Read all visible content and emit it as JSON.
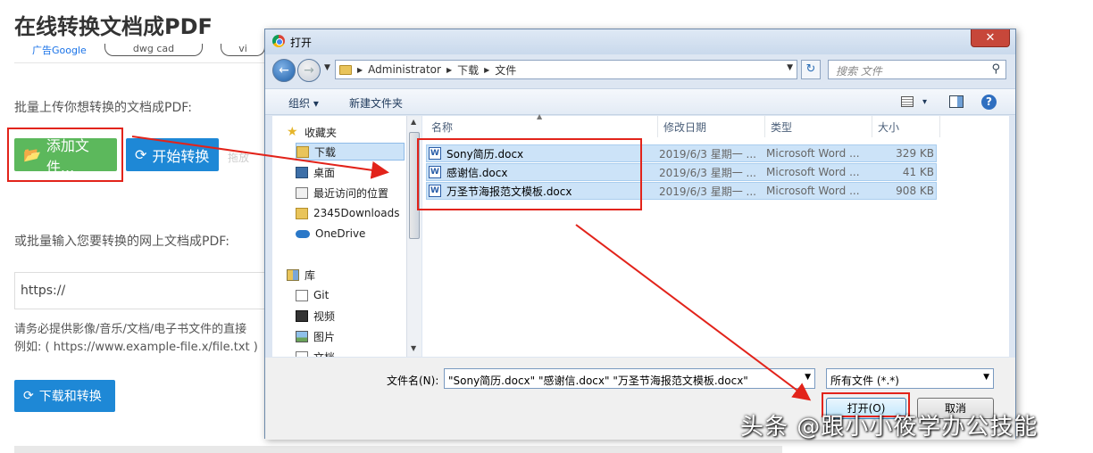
{
  "page": {
    "title": "在线转换文档成PDF",
    "ads": {
      "label": "广告Google",
      "chips": [
        "dwg cad",
        "vi"
      ]
    },
    "upload_prompt": "批量上传你想转换的文档成PDF:",
    "add_files_label": "添加文件...",
    "start_convert_label": "开始转换",
    "drag_hint": "拖放",
    "url_prompt": "或批量输入您要转换的网上文档成PDF:",
    "url_placeholder": "https://",
    "notice_line1": "请务必提供影像/音乐/文档/电子书文件的直接",
    "notice_line2": "例如: ( https://www.example-file.x/file.txt )",
    "download_convert_label": "下载和转换",
    "colors": {
      "green": "#5cb85c",
      "blue": "#1e88d6"
    }
  },
  "dialog": {
    "title": "打开",
    "close_label": "✕",
    "breadcrumb": [
      "Administrator",
      "下载",
      "文件"
    ],
    "search_placeholder": "搜索 文件",
    "toolbar": {
      "organize": "组织 ▾",
      "new_folder": "新建文件夹",
      "view_dropdown": "▾"
    },
    "nav": {
      "favorites": "收藏夹",
      "downloads": "下载",
      "desktop": "桌面",
      "recent": "最近访问的位置",
      "downloads2345": "2345Downloads",
      "onedrive": "OneDrive",
      "library": "库",
      "git": "Git",
      "videos": "视频",
      "pictures": "图片",
      "documents": "文档"
    },
    "columns": {
      "name": "名称",
      "modified": "修改日期",
      "type": "类型",
      "size": "大小"
    },
    "files": [
      {
        "name": "Sony简历.docx",
        "date": "2019/6/3 星期一 ...",
        "type": "Microsoft Word ...",
        "size": "329 KB"
      },
      {
        "name": "感谢信.docx",
        "date": "2019/6/3 星期一 ...",
        "type": "Microsoft Word ...",
        "size": "41 KB"
      },
      {
        "name": "万圣节海报范文模板.docx",
        "date": "2019/6/3 星期一 ...",
        "type": "Microsoft Word ...",
        "size": "908 KB"
      }
    ],
    "filename_label": "文件名(N):",
    "filename_value": "\"Sony简历.docx\" \"感谢信.docx\" \"万圣节海报范文模板.docx\"",
    "filetype_value": "所有文件 (*.*)",
    "open_label": "打开(O)",
    "cancel_label": "取消"
  },
  "watermark": "头条 @跟小小筱学办公技能",
  "annotation_color": "#e2231a"
}
